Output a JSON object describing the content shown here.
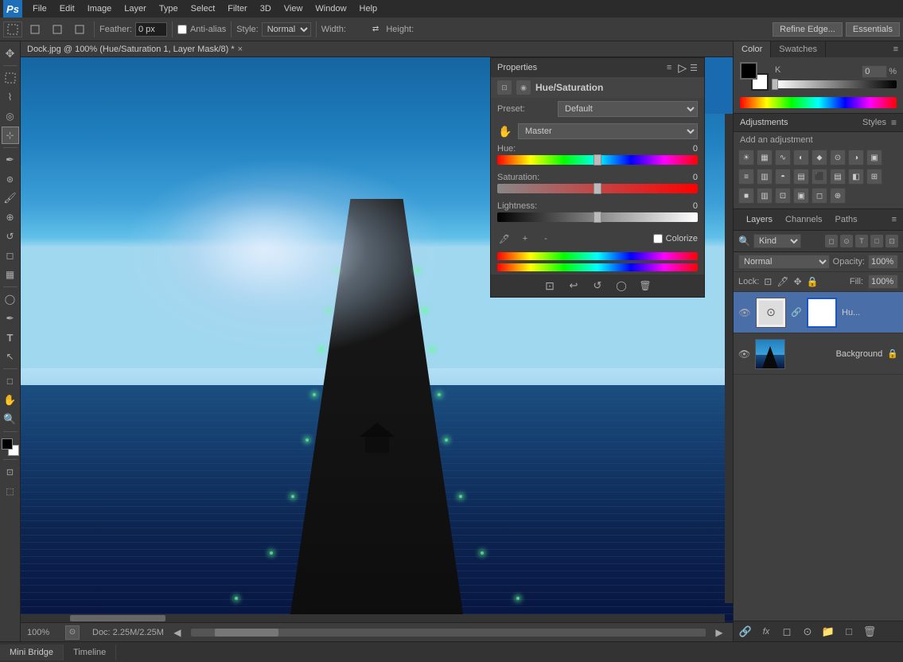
{
  "app": {
    "name": "Adobe Photoshop",
    "logo": "Ps",
    "workspace": "Essentials"
  },
  "menubar": {
    "items": [
      "File",
      "Edit",
      "Image",
      "Layer",
      "Type",
      "Select",
      "Filter",
      "3D",
      "View",
      "Window",
      "Help"
    ]
  },
  "toolbar": {
    "feather_label": "Feather:",
    "feather_value": "0 px",
    "antialias_label": "Anti-alias",
    "style_label": "Style:",
    "style_value": "Normal",
    "width_label": "Width:",
    "height_label": "Height:",
    "refine_label": "Refine Edge...",
    "essentials_label": "Essentials"
  },
  "canvas": {
    "tab_name": "Dock.jpg @ 100% (Hue/Saturation 1, Layer Mask/8) *",
    "zoom": "100%",
    "doc_info": "Doc: 2.25M/2.25M"
  },
  "properties": {
    "title": "Properties",
    "layer_type": "Hue/Saturation",
    "preset_label": "Preset:",
    "preset_value": "Default",
    "channel_label": "Master",
    "hue_label": "Hue:",
    "hue_value": "0",
    "saturation_label": "Saturation:",
    "saturation_value": "0",
    "lightness_label": "Lightness:",
    "lightness_value": "0",
    "colorize_label": "Colorize"
  },
  "color_panel": {
    "color_tab": "Color",
    "swatches_tab": "Swatches",
    "k_label": "K",
    "k_value": "0",
    "k_percent": "%"
  },
  "adjustments": {
    "title": "Adjustments",
    "styles_tab": "Styles",
    "subtitle": "Add an adjustment",
    "icons": [
      "☀",
      "∿",
      "▦",
      "⬥",
      "⊙",
      "◑",
      "▣",
      "≡",
      "◐",
      "▥",
      "◧",
      "⬛",
      "▤",
      "◓",
      "■",
      "⊞"
    ]
  },
  "layers": {
    "title": "Layers",
    "channels_tab": "Channels",
    "paths_tab": "Paths",
    "search_placeholder": "Kind",
    "blend_mode": "Normal",
    "opacity_label": "Opacity:",
    "opacity_value": "100%",
    "lock_label": "Lock:",
    "fill_label": "Fill:",
    "fill_value": "100%",
    "items": [
      {
        "name": "Hu...",
        "type": "hue_saturation",
        "visible": true,
        "has_mask": true
      },
      {
        "name": "Background",
        "type": "background",
        "visible": true,
        "locked": true
      }
    ]
  },
  "bottom_bar": {
    "tabs": [
      "Mini Bridge",
      "Timeline"
    ]
  }
}
